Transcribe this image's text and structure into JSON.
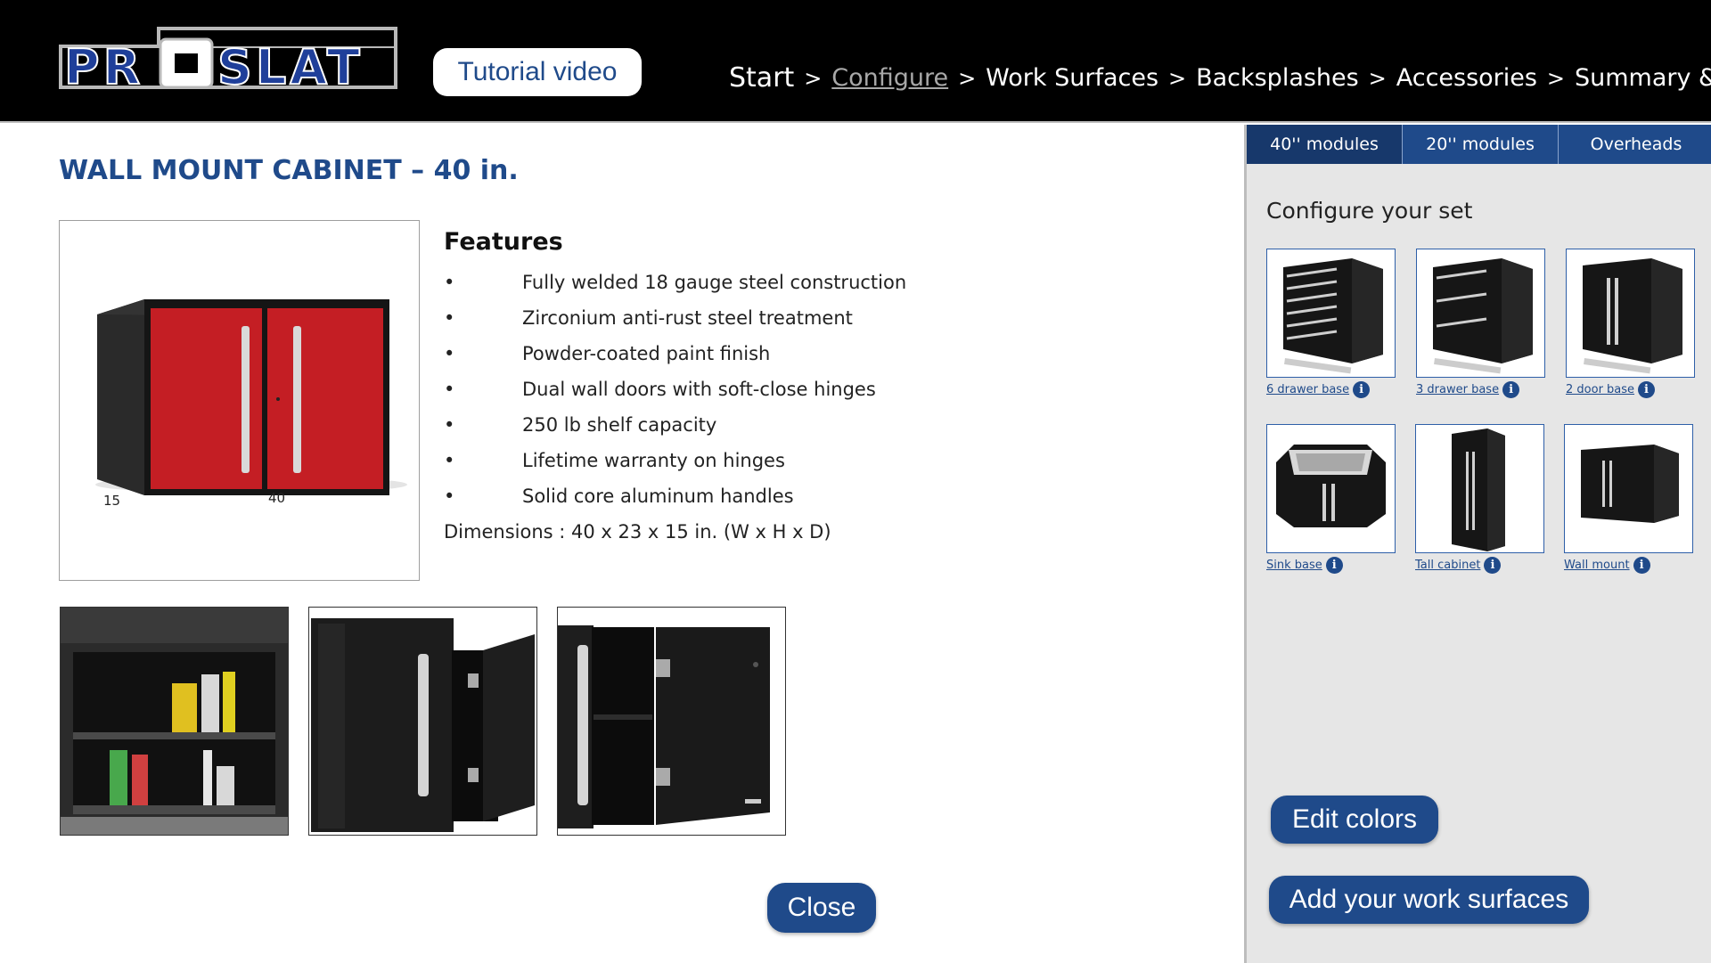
{
  "header": {
    "logo_text": "PROSLAT",
    "tutorial_label": "Tutorial video",
    "breadcrumb": [
      "Start",
      "Configure",
      "Work Surfaces",
      "Backsplashes",
      "Accessories",
      "Summary & quote"
    ],
    "separator": ">"
  },
  "product": {
    "title": "WALL MOUNT CABINET – 40 in.",
    "dim_depth": "15",
    "dim_width": "40",
    "features_heading": "Features",
    "bullet": "•",
    "features": [
      "Fully welded 18 gauge steel construction",
      "Zirconium anti-rust steel treatment",
      "Powder-coated paint finish",
      "Dual wall doors  with soft-close hinges",
      "250 lb shelf capacity",
      "Lifetime warranty on hinges",
      "Solid core aluminum handles"
    ],
    "dimensions": "Dimensions : 40 x 23 x 15 in. (W x H x D)",
    "close_label": "Close"
  },
  "panel": {
    "tabs": [
      "40'' modules",
      "20'' modules",
      "Overheads"
    ],
    "title": "Configure your set",
    "modules": [
      {
        "label": "6 drawer base"
      },
      {
        "label": "3 drawer base"
      },
      {
        "label": "2 door base"
      },
      {
        "label": "Sink base"
      },
      {
        "label": "Tall cabinet"
      },
      {
        "label": "Wall mount"
      }
    ],
    "info_glyph": "i",
    "edit_colors_label": "Edit colors",
    "add_surfaces_label": "Add your work surfaces"
  },
  "colors": {
    "brand_blue": "#1f4a8a",
    "cabinet_red": "#c41e24",
    "cabinet_black": "#1a1a1a"
  }
}
